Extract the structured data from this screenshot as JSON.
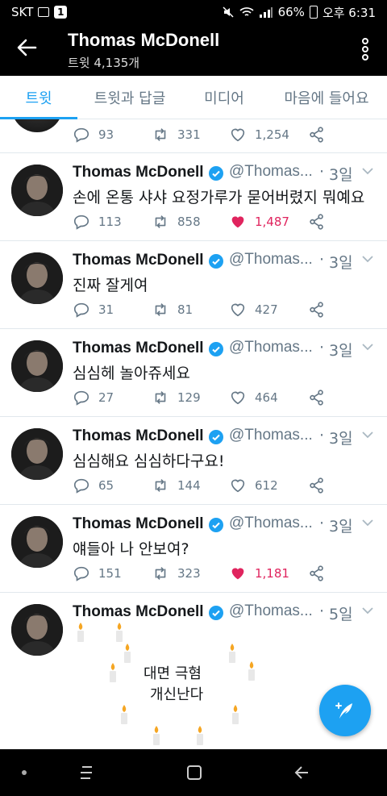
{
  "status": {
    "carrier": "SKT",
    "battery": "66%",
    "time": "오후 6:31",
    "badge": "1"
  },
  "header": {
    "title": "Thomas McDonell",
    "subtitle": "트윗 4,135개"
  },
  "tabs": [
    {
      "label": "트윗",
      "active": true
    },
    {
      "label": "트윗과 답글",
      "active": false
    },
    {
      "label": "미디어",
      "active": false
    },
    {
      "label": "마음에 들어요",
      "active": false
    }
  ],
  "partial_tweet": {
    "replies": "93",
    "retweets": "331",
    "likes": "1,254"
  },
  "tweets": [
    {
      "name": "Thomas McDonell",
      "handle": "@Thomas...",
      "dot": "·",
      "time": "3일",
      "text": "손에 온통 샤샤 요정가루가 묻어버렸지 뭐예요",
      "replies": "113",
      "retweets": "858",
      "likes": "1,487",
      "liked": true
    },
    {
      "name": "Thomas McDonell",
      "handle": "@Thomas...",
      "dot": "·",
      "time": "3일",
      "text": "진짜 잘게여",
      "replies": "31",
      "retweets": "81",
      "likes": "427",
      "liked": false
    },
    {
      "name": "Thomas McDonell",
      "handle": "@Thomas...",
      "dot": "·",
      "time": "3일",
      "text": "심심헤 놀아쥬세요",
      "replies": "27",
      "retweets": "129",
      "likes": "464",
      "liked": false
    },
    {
      "name": "Thomas McDonell",
      "handle": "@Thomas...",
      "dot": "·",
      "time": "3일",
      "text": "심심해요 심심하다구요!",
      "replies": "65",
      "retweets": "144",
      "likes": "612",
      "liked": false
    },
    {
      "name": "Thomas McDonell",
      "handle": "@Thomas...",
      "dot": "·",
      "time": "3일",
      "text": "얘들아 나 안보여?",
      "replies": "151",
      "retweets": "323",
      "likes": "1,181",
      "liked": true
    }
  ],
  "last_tweet": {
    "name": "Thomas McDonell",
    "handle": "@Thomas...",
    "dot": "·",
    "time": "5일",
    "line1": "대면 극혐",
    "line2": "개신난다"
  },
  "colors": {
    "accent": "#1da1f2",
    "like": "#e0245e",
    "muted": "#657786"
  }
}
